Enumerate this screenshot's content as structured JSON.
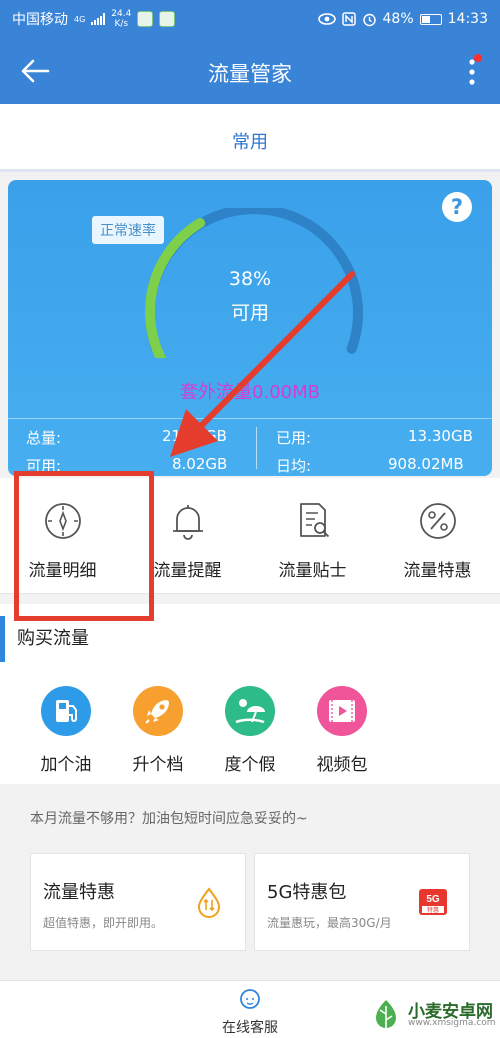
{
  "status_bar": {
    "carrier": "中国移动",
    "network": "4G",
    "speed_value": "24.4",
    "speed_unit": "K/s",
    "battery": "48%",
    "time": "14:33",
    "icons": [
      "wifi-calling-icon",
      "nfc-icon",
      "alarm-icon"
    ]
  },
  "app_bar": {
    "title": "流量管家",
    "has_notification_dot": true
  },
  "tabs": {
    "active": "常用"
  },
  "usage_card": {
    "speed_badge": "正常速率",
    "percent": "38%",
    "status": "可用",
    "extra_traffic": "套外流量0.00MB",
    "gauge_level": 0.38,
    "stats": {
      "total_label": "总量:",
      "total_value": "21.35GB",
      "available_label": "可用:",
      "available_value": "8.02GB",
      "used_label": "已用:",
      "used_value": "13.30GB",
      "daily_label": "日均:",
      "daily_value": "908.02MB"
    }
  },
  "tools": [
    {
      "label": "流量明细",
      "icon": "compass-icon"
    },
    {
      "label": "流量提醒",
      "icon": "bell-icon"
    },
    {
      "label": "流量贴士",
      "icon": "document-search-icon"
    },
    {
      "label": "流量特惠",
      "icon": "percent-icon"
    }
  ],
  "buy": {
    "title": "购买流量",
    "packages": [
      {
        "label": "加个油",
        "icon": "fuel-pump-icon",
        "color": "#2e9be8"
      },
      {
        "label": "升个档",
        "icon": "rocket-icon",
        "color": "#f7a030"
      },
      {
        "label": "度个假",
        "icon": "beach-icon",
        "color": "#2dbb88"
      },
      {
        "label": "视频包",
        "icon": "film-icon",
        "color": "#f0559a"
      }
    ]
  },
  "tip": "本月流量不够用？加油包短时间应急妥妥的~",
  "offers": [
    {
      "title": "流量特惠",
      "subtitle": "超值特惠，即开即用。",
      "icon": "drop-arrows-icon"
    },
    {
      "title": "5G特惠包",
      "subtitle": "流量惠玩，最高30G/月",
      "icon": "5g-badge-icon",
      "badge": "5G",
      "badge_sub": "特惠"
    }
  ],
  "footer": {
    "service_label": "在线客服"
  },
  "watermark": {
    "name": "小麦安卓网",
    "url": "www.xmsigma.com"
  },
  "colors": {
    "primary": "#3a84d8",
    "card": "#3aa0ea",
    "annotation": "#e43d2e",
    "extra_text": "#d63cd3"
  }
}
